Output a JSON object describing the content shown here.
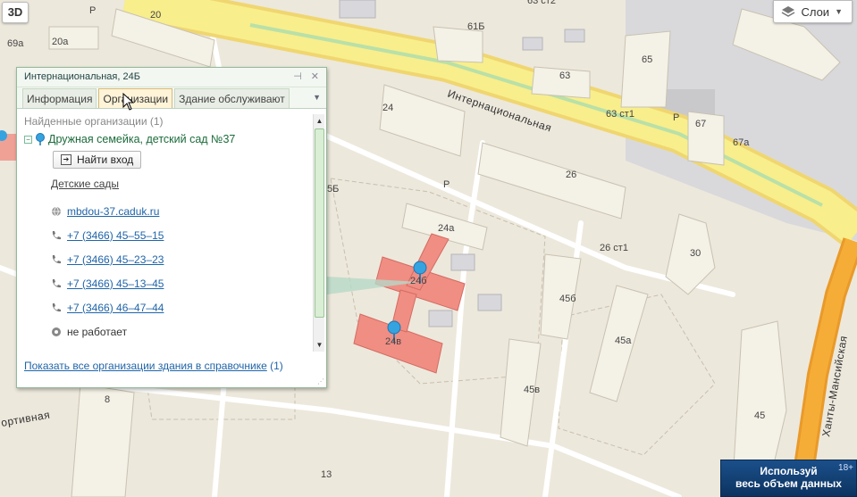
{
  "map": {
    "street_internationalnaya": "Интернациональная",
    "street_khanty": "Ханты-Мансийская",
    "street_sportivnaya": "ортивная",
    "buildings": [
      "20",
      "20а",
      "69а",
      "24",
      "61Б",
      "63 ст2",
      "63",
      "65",
      "67",
      "67а",
      "63 ст1",
      "26",
      "24а",
      "26 ст1",
      "30",
      "24б",
      "24в",
      "45б",
      "45а",
      "45в",
      "45",
      "8",
      "13",
      "5Б",
      "Р",
      "Р",
      "Р"
    ]
  },
  "controls": {
    "btn_3d": "3D",
    "layers_label": "Слои"
  },
  "banner": {
    "line1": "Используй",
    "line2": "весь объем данных",
    "age": "18+"
  },
  "popup": {
    "title": "Интернациональная, 24Б",
    "tabs": [
      "Информация",
      "Организации",
      "Здание обслуживают"
    ],
    "active_tab": "Организации",
    "found_label": "Найденные организации (1)",
    "org_name": "Дружная семейка, детский сад №37",
    "entry_button": "Найти вход",
    "category": "Детские сады",
    "website": "mbdou-37.caduk.ru",
    "phones": [
      "+7 (3466) 45–55–15",
      "+7 (3466) 45–23–23",
      "+7 (3466) 45–13–45",
      "+7 (3466) 46–47–44"
    ],
    "status": "не работает",
    "footer_link": "Показать все организации здания в справочнике",
    "footer_count": "(1)",
    "colors": {
      "accent_green": "#1b6b3a",
      "link_blue": "#2065a8",
      "border": "#93b99a"
    }
  }
}
